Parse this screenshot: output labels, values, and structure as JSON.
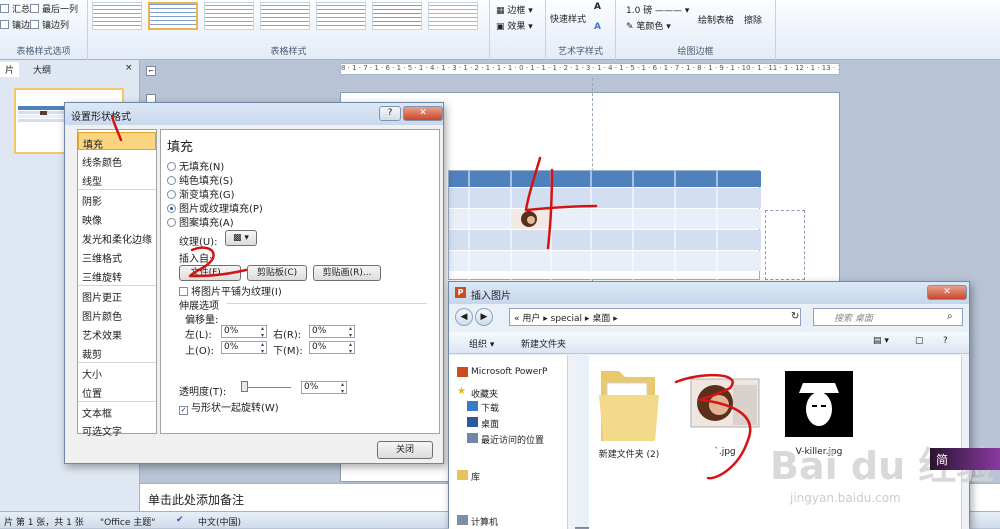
{
  "ribbon": {
    "table_style_options": {
      "label": "表格样式选项",
      "items": [
        "汇总行",
        "最后一列",
        "镶边行",
        "镶边列"
      ],
      "visible_fragments": [
        "汇总行",
        "最后一列",
        "镶边行",
        "镶边列"
      ]
    },
    "table_styles_label": "表格样式",
    "border_label": "边框",
    "effects_label": "效果",
    "art_text": {
      "quick_styles": "快速样式",
      "label": "艺术字样式"
    },
    "draw_borders": {
      "label": "绘图边框",
      "pen_weight": "1.0 磅",
      "pen_color": "笔颜色",
      "draw_table": "绘制表格",
      "eraser": "擦除"
    }
  },
  "left_pane": {
    "tab_slides": "片",
    "tab_outline": "大纲",
    "close": "×"
  },
  "ruler_text": "8 · 1 · 7 · 1 · 6 · 1 · 5 · 1 · 4 · 1 · 3 · 1 · 2 · 1 · 1 · 1 · 0 · 1 · 1 · 1 · 2 · 1 · 3 · 1 · 4 · 1 · 5 · 1 · 6 · 1 · 7 · 1 · 8 · 1 · 9 · 1 · 10 · 1 · 11 · 1 · 12 · 1 · 13 · 1 · 14 · 1 · 15 · 1 · 16",
  "notes_placeholder": "单击此处添加备注",
  "status": {
    "slide": "片 第 1 张，共 1 张",
    "theme": "\"Office 主题\"",
    "language": "中文(中国)"
  },
  "format_dialog": {
    "title": "设置形状格式",
    "help": "?",
    "close_x": "✕",
    "nav": [
      "填充",
      "线条颜色",
      "线型",
      "阴影",
      "映像",
      "发光和柔化边缘",
      "三维格式",
      "三维旋转",
      "图片更正",
      "图片颜色",
      "艺术效果",
      "裁剪",
      "大小",
      "位置",
      "文本框",
      "可选文字"
    ],
    "selected_nav": 0,
    "panel_title": "填充",
    "fill_options": [
      "无填充(N)",
      "纯色填充(S)",
      "渐变填充(G)",
      "图片或纹理填充(P)",
      "图案填充(A)"
    ],
    "fill_selected": 3,
    "texture_label": "纹理(U):",
    "insert_from": "插入自:",
    "btn_file": "文件(F)...",
    "btn_clipboard": "剪贴板(C)",
    "btn_clipart": "剪贴画(R)...",
    "tile_label": "将图片平铺为纹理(I)",
    "stretch_options": "伸展选项",
    "offsets": "偏移量:",
    "left_label": "左(L):",
    "right_label": "右(R):",
    "top_label": "上(O):",
    "bottom_label": "下(M):",
    "left_val": "0%",
    "right_val": "0%",
    "top_val": "0%",
    "bottom_val": "0%",
    "transparency_label": "透明度(T):",
    "transparency_val": "0%",
    "rotate_label": "与形状一起旋转(W)",
    "close_button": "关闭"
  },
  "insert_dialog": {
    "title": "插入图片",
    "path": [
      "«",
      "用户",
      "special",
      "桌面"
    ],
    "search_placeholder": "搜索 桌面",
    "organize": "组织 ▾",
    "new_folder": "新建文件夹",
    "tree": [
      "Microsoft PowerP",
      "收藏夹",
      "下载",
      "桌面",
      "最近访问的位置",
      "库",
      "计算机"
    ],
    "files": [
      {
        "name": "新建文件夹 (2)",
        "type": "folder"
      },
      {
        "name": "`.jpg",
        "type": "image"
      },
      {
        "name": "V-killer.jpg",
        "type": "image"
      }
    ]
  },
  "watermark": {
    "brand": "Bai du 经验",
    "site": "jingyan.baidu.com",
    "tag": "简"
  },
  "annotations": {
    "numbers": [
      "1",
      "2",
      "3",
      "4"
    ],
    "color": "#d41414"
  },
  "colors": {
    "accent": "#f8d57e",
    "table_header": "#4f81bd",
    "table_band": "#d3dff0"
  }
}
